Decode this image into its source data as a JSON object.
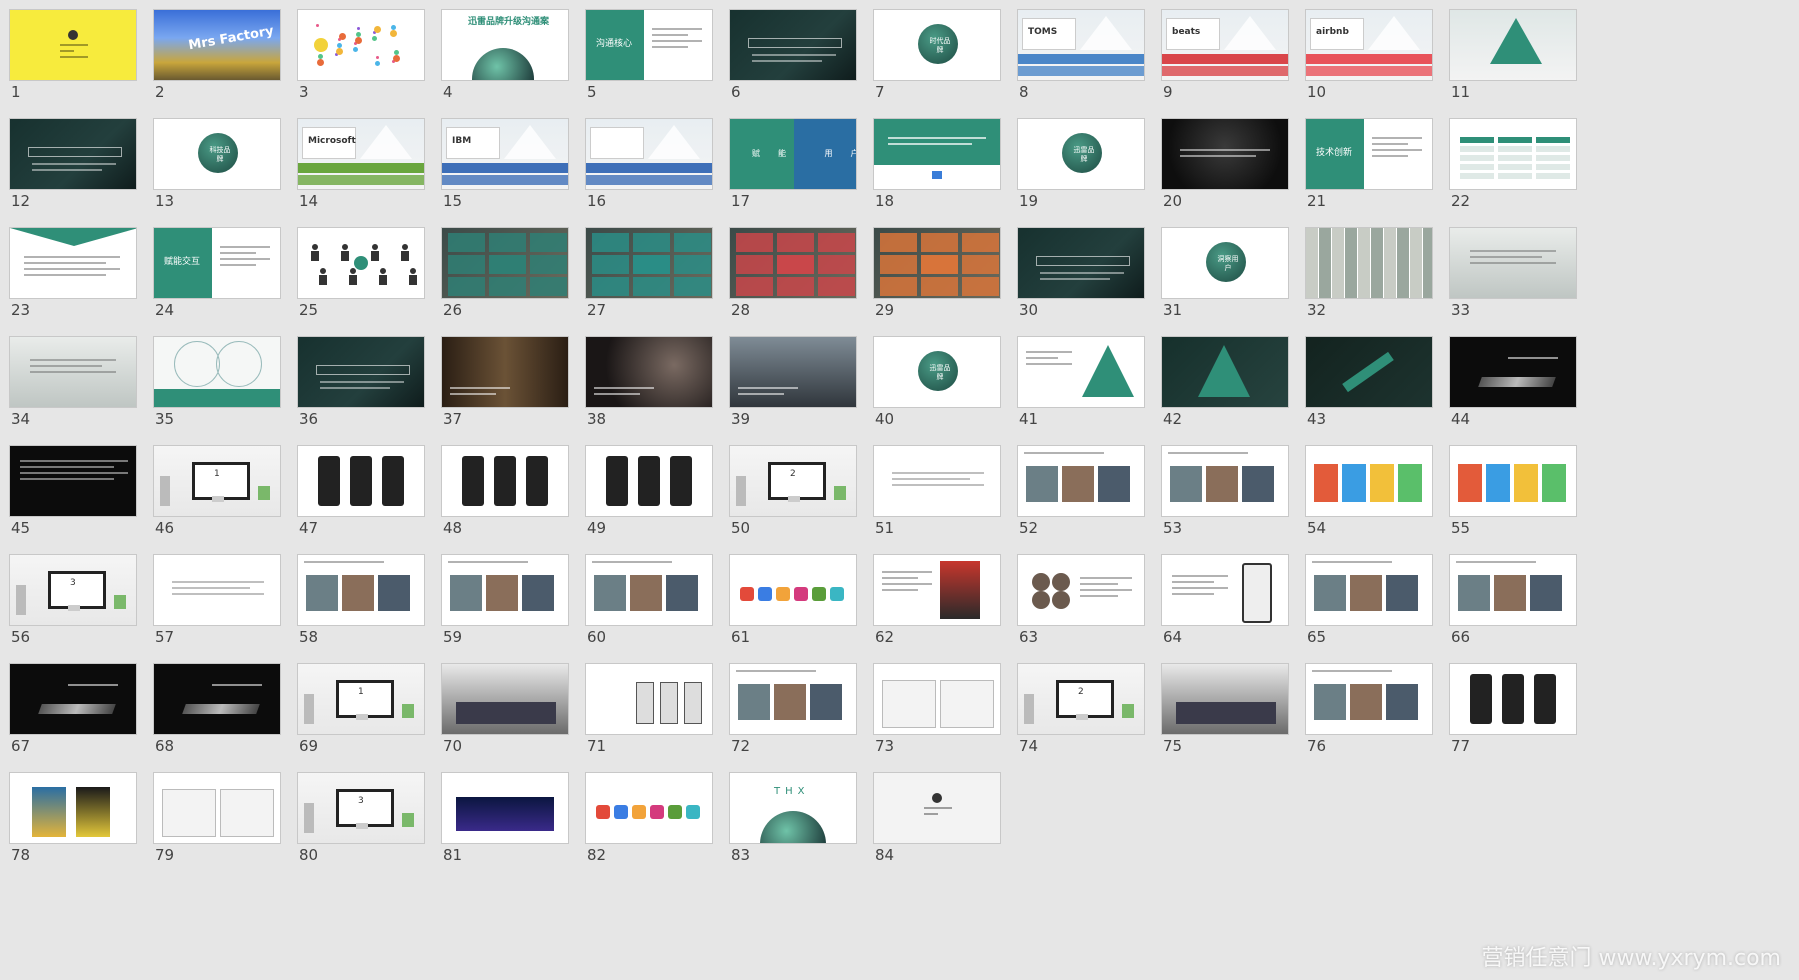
{
  "slides": [
    {
      "n": "1",
      "kind": "yellow"
    },
    {
      "n": "2",
      "kind": "photo-building",
      "text": "Mrs Factory"
    },
    {
      "n": "3",
      "kind": "dots"
    },
    {
      "n": "4",
      "kind": "white-title-planet",
      "text": "迅雷品牌升级沟通案"
    },
    {
      "n": "5",
      "kind": "green-left",
      "text": "沟通核心"
    },
    {
      "n": "6",
      "kind": "dark-teal"
    },
    {
      "n": "7",
      "kind": "white-circle",
      "text": "时代品牌"
    },
    {
      "n": "8",
      "kind": "brand-tri",
      "text": "TOMS",
      "color": "#4a86c8"
    },
    {
      "n": "9",
      "kind": "brand-tri",
      "text": "beats",
      "color": "#d9464a"
    },
    {
      "n": "10",
      "kind": "brand-tri",
      "text": "airbnb",
      "color": "#e8535a"
    },
    {
      "n": "11",
      "kind": "tri-photo"
    },
    {
      "n": "12",
      "kind": "dark-teal"
    },
    {
      "n": "13",
      "kind": "white-circle",
      "text": "科技品牌"
    },
    {
      "n": "14",
      "kind": "brand-tri",
      "text": "Microsoft",
      "color": "#6aa63e"
    },
    {
      "n": "15",
      "kind": "brand-tri",
      "text": "IBM",
      "color": "#3e6fb8"
    },
    {
      "n": "16",
      "kind": "brand-tri",
      "text": "",
      "color": "#3e6fb8"
    },
    {
      "n": "17",
      "kind": "green-blue",
      "text": "赋能 用户"
    },
    {
      "n": "18",
      "kind": "green-top"
    },
    {
      "n": "19",
      "kind": "white-circle",
      "text": "迅雷品牌"
    },
    {
      "n": "20",
      "kind": "dark"
    },
    {
      "n": "21",
      "kind": "green-left",
      "text": "技术创新"
    },
    {
      "n": "22",
      "kind": "white-table"
    },
    {
      "n": "23",
      "kind": "white-chevron"
    },
    {
      "n": "24",
      "kind": "green-left",
      "text": "赋能交互"
    },
    {
      "n": "25",
      "kind": "people-diagram"
    },
    {
      "n": "26",
      "kind": "grid-teal"
    },
    {
      "n": "27",
      "kind": "grid-teal2"
    },
    {
      "n": "28",
      "kind": "grid-red"
    },
    {
      "n": "29",
      "kind": "grid-orange"
    },
    {
      "n": "30",
      "kind": "dark-teal-text"
    },
    {
      "n": "31",
      "kind": "white-circle",
      "text": "洞察用户"
    },
    {
      "n": "32",
      "kind": "photo-strip"
    },
    {
      "n": "33",
      "kind": "photo-light"
    },
    {
      "n": "34",
      "kind": "photo-light"
    },
    {
      "n": "35",
      "kind": "venn-green"
    },
    {
      "n": "36",
      "kind": "dark-teal"
    },
    {
      "n": "37",
      "kind": "photo-dark"
    },
    {
      "n": "38",
      "kind": "photo-hand"
    },
    {
      "n": "39",
      "kind": "photo-city"
    },
    {
      "n": "40",
      "kind": "white-circle",
      "text": "迅雷品牌"
    },
    {
      "n": "41",
      "kind": "white-pyramid"
    },
    {
      "n": "42",
      "kind": "dark-pyramid"
    },
    {
      "n": "43",
      "kind": "dark-phone"
    },
    {
      "n": "44",
      "kind": "black-phone"
    },
    {
      "n": "45",
      "kind": "black-text"
    },
    {
      "n": "46",
      "kind": "desk",
      "text": "1"
    },
    {
      "n": "47",
      "kind": "phones"
    },
    {
      "n": "48",
      "kind": "phones"
    },
    {
      "n": "49",
      "kind": "phones"
    },
    {
      "n": "50",
      "kind": "desk",
      "text": "2"
    },
    {
      "n": "51",
      "kind": "white-text"
    },
    {
      "n": "52",
      "kind": "white-photos"
    },
    {
      "n": "53",
      "kind": "white-photos"
    },
    {
      "n": "54",
      "kind": "white-colorful"
    },
    {
      "n": "55",
      "kind": "white-colorful"
    },
    {
      "n": "56",
      "kind": "desk",
      "text": "3"
    },
    {
      "n": "57",
      "kind": "white-text"
    },
    {
      "n": "58",
      "kind": "white-photos"
    },
    {
      "n": "59",
      "kind": "white-photos"
    },
    {
      "n": "60",
      "kind": "white-photos"
    },
    {
      "n": "61",
      "kind": "white-icons"
    },
    {
      "n": "62",
      "kind": "white-magazine"
    },
    {
      "n": "63",
      "kind": "white-hex"
    },
    {
      "n": "64",
      "kind": "white-phone"
    },
    {
      "n": "65",
      "kind": "white-photos"
    },
    {
      "n": "66",
      "kind": "white-photos"
    },
    {
      "n": "67",
      "kind": "black-phone2"
    },
    {
      "n": "68",
      "kind": "black-phone2"
    },
    {
      "n": "69",
      "kind": "desk",
      "text": "1"
    },
    {
      "n": "70",
      "kind": "photo-event"
    },
    {
      "n": "71",
      "kind": "white-phones3"
    },
    {
      "n": "72",
      "kind": "white-photos"
    },
    {
      "n": "73",
      "kind": "white-web"
    },
    {
      "n": "74",
      "kind": "desk",
      "text": "2"
    },
    {
      "n": "75",
      "kind": "photo-event"
    },
    {
      "n": "76",
      "kind": "white-photos"
    },
    {
      "n": "77",
      "kind": "phones"
    },
    {
      "n": "78",
      "kind": "white-posters"
    },
    {
      "n": "79",
      "kind": "white-web"
    },
    {
      "n": "80",
      "kind": "desk",
      "text": "3"
    },
    {
      "n": "81",
      "kind": "white-stage"
    },
    {
      "n": "82",
      "kind": "white-icons"
    },
    {
      "n": "83",
      "kind": "thx",
      "text": "THX"
    },
    {
      "n": "84",
      "kind": "end"
    }
  ],
  "watermark": "营销任意门 www.yxrym.com"
}
